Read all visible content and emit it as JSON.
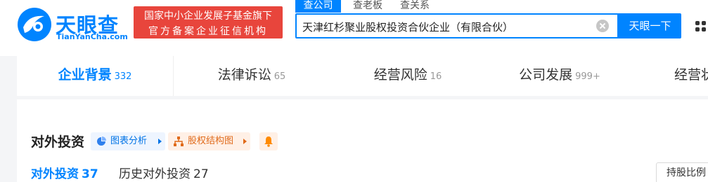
{
  "brand": {
    "name_cn": "天眼查",
    "name_en": "TianYanCha.com",
    "color": "#0084ff"
  },
  "gov_badge": {
    "line1": "国家中小企业发展子基金旗下",
    "line2": "官方备案企业征信机构",
    "color": "#e8453c"
  },
  "search": {
    "tabs": [
      "查公司",
      "查老板",
      "查关系"
    ],
    "active_tab": "查公司",
    "value": "天津红杉聚业股权投资合伙企业（有限合伙）",
    "button_label": "天眼一下"
  },
  "nav": {
    "items": [
      {
        "label": "企业背景",
        "count": "332",
        "active": true
      },
      {
        "label": "法律诉讼",
        "count": "65",
        "active": false
      },
      {
        "label": "经营风险",
        "count": "16",
        "active": false
      },
      {
        "label": "公司发展",
        "count": "999+",
        "active": false
      },
      {
        "label": "经营状况",
        "count": "",
        "active": false
      }
    ]
  },
  "section": {
    "title": "对外投资",
    "chart_analysis_label": "图表分析",
    "equity_structure_label": "股权结构图",
    "sub_tabs": [
      {
        "label": "对外投资",
        "count": "37",
        "active": true
      },
      {
        "label": "历史对外投资",
        "count": "27",
        "active": false
      }
    ],
    "sort_label": "持股比例"
  },
  "icons": {
    "logo": "tianyancha-logo-icon",
    "clear": "clear-icon",
    "apps": "grid-icon",
    "chart": "chart-icon",
    "equity": "equity-structure-icon",
    "bell": "bell-icon"
  }
}
